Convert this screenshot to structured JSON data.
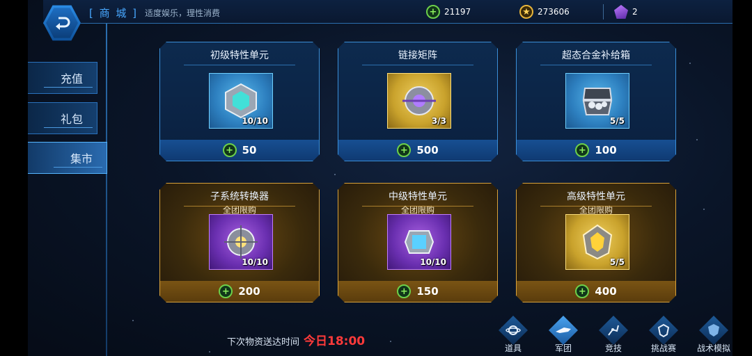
{
  "header": {
    "title": "[ 商 城 ]",
    "subtitle": "适度娱乐，理性消费",
    "resources": [
      {
        "icon": "green-coin-icon",
        "value": "21197"
      },
      {
        "icon": "gold-coin-icon",
        "value": "273606"
      },
      {
        "icon": "purple-gem-icon",
        "value": "2"
      }
    ]
  },
  "sidebar": {
    "items": [
      {
        "label": "充值",
        "active": false
      },
      {
        "label": "礼包",
        "active": false
      },
      {
        "label": "集市",
        "active": true
      }
    ]
  },
  "shop": {
    "cards": [
      {
        "title": "初级特性单元",
        "limit": "",
        "count": "10/10",
        "price": "50",
        "rarity": "blue"
      },
      {
        "title": "链接矩阵",
        "limit": "",
        "count": "3/3",
        "price": "500",
        "rarity": "yellow"
      },
      {
        "title": "超态合金补给箱",
        "limit": "",
        "count": "5/5",
        "price": "100",
        "rarity": "blue"
      },
      {
        "title": "子系统转换器",
        "limit": "全团限购",
        "count": "10/10",
        "price": "200",
        "rarity": "purple"
      },
      {
        "title": "中级特性单元",
        "limit": "全团限购",
        "count": "10/10",
        "price": "150",
        "rarity": "purple"
      },
      {
        "title": "高级特性单元",
        "limit": "全团限购",
        "count": "5/5",
        "price": "400",
        "rarity": "yellow"
      }
    ]
  },
  "footer": {
    "refresh_label": "下次物资送达时间",
    "refresh_time": "今日18:00"
  },
  "dock": {
    "items": [
      {
        "label": "道具",
        "icon": "planet-icon"
      },
      {
        "label": "军团",
        "icon": "ship-icon",
        "active": true
      },
      {
        "label": "竞技",
        "icon": "robot-arm-icon"
      },
      {
        "label": "挑战赛",
        "icon": "crest-icon"
      },
      {
        "label": "战术模拟",
        "icon": "emblem-icon"
      }
    ]
  },
  "colors": {
    "accent_blue": "#3b8fd8",
    "accent_gold": "#d9a23a",
    "refresh_red": "#ff3a3a"
  }
}
